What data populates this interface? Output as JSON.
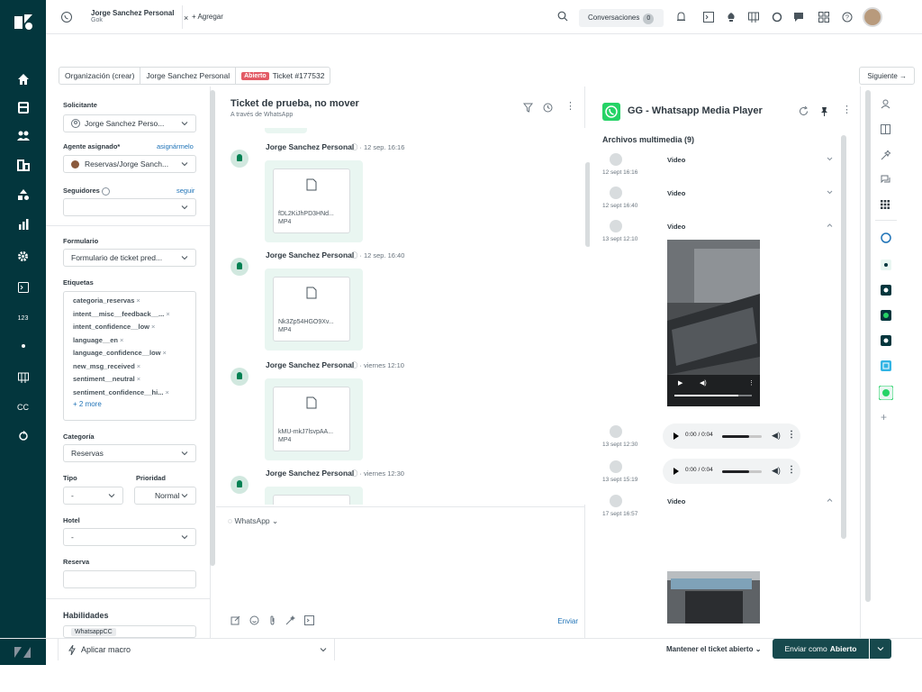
{
  "colors": {
    "nav_bg": "#03363d",
    "accent_blue": "#1f73b7",
    "open_badge": "#e35b66",
    "submit_bg": "#17494d",
    "bubble_bg": "#e9f6f1",
    "whatsapp_green": "#25d366"
  },
  "left_nav": {
    "items": [
      {
        "icon": "home-icon"
      },
      {
        "icon": "views-icon"
      },
      {
        "icon": "customers-icon"
      },
      {
        "icon": "organizations-icon"
      },
      {
        "icon": "guide-icon"
      },
      {
        "icon": "reporting-icon"
      },
      {
        "icon": "admin-icon"
      },
      {
        "icon": "console-icon"
      },
      {
        "icon": "numbers-icon",
        "label": "123"
      },
      {
        "icon": "talk-icon"
      },
      {
        "icon": "apps-icon"
      },
      {
        "icon": "captions-icon",
        "label": "CC"
      },
      {
        "icon": "sync-icon"
      }
    ]
  },
  "topbar": {
    "tab_title": "Jorge Sanchez Personal",
    "tab_subtitle": "Gok",
    "add_label": "+ Agregar",
    "conversations_label": "Conversaciones",
    "conversations_count": "0"
  },
  "breadcrumb": {
    "org": "Organización (crear)",
    "requester": "Jorge Sanchez Personal",
    "status_badge": "Abierto",
    "ticket": "Ticket #177532",
    "next_label": "Siguiente →"
  },
  "properties": {
    "requester_label": "Solicitante",
    "requester_value": "Jorge Sanchez Perso...",
    "assignee_label": "Agente asignado*",
    "assign_me": "asignármelo",
    "assignee_value": "Reservas/Jorge Sanch...",
    "followers_label": "Seguidores",
    "follow_link": "seguir",
    "form_label": "Formulario",
    "form_value": "Formulario de ticket pred...",
    "tags_label": "Etiquetas",
    "tags": [
      "categoria_reservas",
      "intent__misc__feedback__...",
      "intent_confidence__low",
      "language__en",
      "language_confidence__low",
      "new_msg_received",
      "sentiment__neutral",
      "sentiment_confidence__hi..."
    ],
    "more_tags": "+ 2 more",
    "category_label": "Categoría",
    "category_value": "Reservas",
    "type_label": "Tipo",
    "type_value": "-",
    "priority_label": "Prioridad",
    "priority_value": "Normal",
    "hotel_label": "Hotel",
    "hotel_value": "-",
    "booking_label": "Reserva",
    "skills_label": "Habilidades",
    "skills_value": "WhatsappCC"
  },
  "conversation": {
    "title": "Ticket de prueba, no mover",
    "subtitle": "A través de WhatsApp",
    "messages": [
      {
        "author": "Jorge Sanchez Personal",
        "time": "· 12 sep. 16:16",
        "file": "fDL2KiJhPD3HNd...",
        "type": "MP4"
      },
      {
        "author": "Jorge Sanchez Personal",
        "time": "· 12 sep. 16:40",
        "file": "Nk3Zp54HGO9Xv...",
        "type": "MP4"
      },
      {
        "author": "Jorge Sanchez Personal",
        "time": "· viernes 12:10",
        "file": "kMU-mkJ7lsvpAA...",
        "type": "MP4"
      },
      {
        "author": "Jorge Sanchez Personal",
        "time": "· viernes 12:30",
        "file": "",
        "type": ""
      }
    ],
    "channel": "WhatsApp",
    "send_label": "Enviar"
  },
  "media_player": {
    "title": "GG - Whatsapp Media Player",
    "section": "Archivos multimedia (9)",
    "items": [
      {
        "date": "12 sept 16:16",
        "label": "Video"
      },
      {
        "date": "12 sept 16:40",
        "label": "Video"
      },
      {
        "date": "13 sept 12:10",
        "label": "Video"
      },
      {
        "date": "13 sept 12:30",
        "audio_time": "0:00 / 0:04"
      },
      {
        "date": "13 sept 15:19",
        "audio_time": "0:00 / 0:04"
      },
      {
        "date": "17 sept 16:57",
        "label": "Video"
      }
    ]
  },
  "bottom_bar": {
    "macro_label": "Aplicar macro",
    "keep_open": "Mantener el ticket abierto",
    "submit_prefix": "Enviar como",
    "submit_status": "Abierto"
  }
}
